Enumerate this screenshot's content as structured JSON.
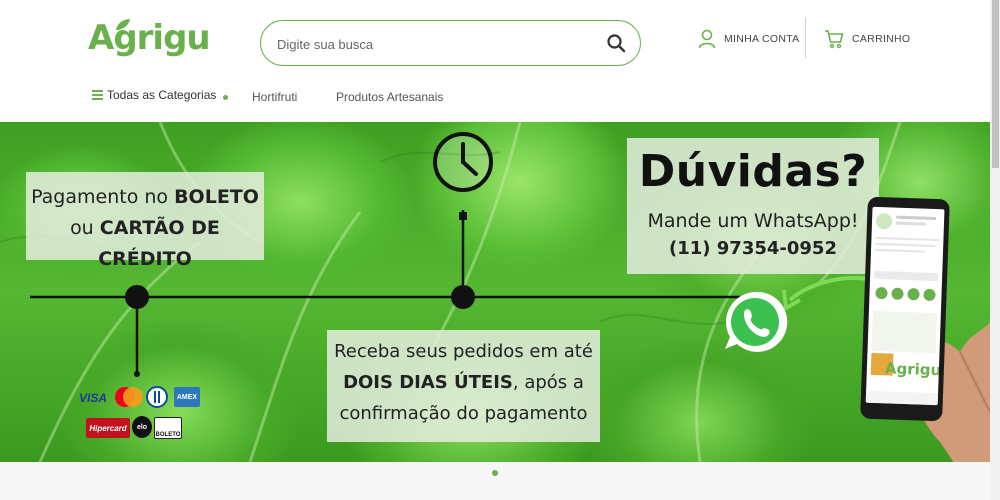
{
  "brand": {
    "logo_text": "Agrigu",
    "accent_color": "#6ab04c"
  },
  "search": {
    "placeholder": "Digite sua busca",
    "icon": "search-icon"
  },
  "account": {
    "label": "MINHA CONTA",
    "icon": "user-icon"
  },
  "cart": {
    "label": "CARRINHO",
    "icon": "cart-icon"
  },
  "nav": {
    "categories_label": "Todas as Categorias",
    "categories_icon": "menu-icon",
    "links": [
      "Hortifruti",
      "Produtos Artesanais"
    ]
  },
  "banner": {
    "payment_line1_prefix": "Pagamento no ",
    "payment_line1_bold": "BOLETO",
    "payment_line2_prefix": "ou ",
    "payment_line2_bold": "CARTÃO DE CRÉDITO",
    "delivery_line1": "Receba seus pedidos em até",
    "delivery_line2_bold": "DOIS DIAS ÚTEIS",
    "delivery_line2_suffix": ", após a",
    "delivery_line3": "confirmação do pagamento",
    "doubts_title": "Dúvidas?",
    "doubts_sub": "Mande um WhatsApp!",
    "doubts_phone": "(11) 97354-0952",
    "phone_logo": "Agrigu",
    "cards": [
      "VISA",
      "AMEX",
      "Hipercard",
      "elo",
      "BOLETO"
    ],
    "icons": [
      "clock-icon",
      "whatsapp-icon"
    ]
  },
  "carousel": {
    "active_index": 0,
    "count": 1
  }
}
